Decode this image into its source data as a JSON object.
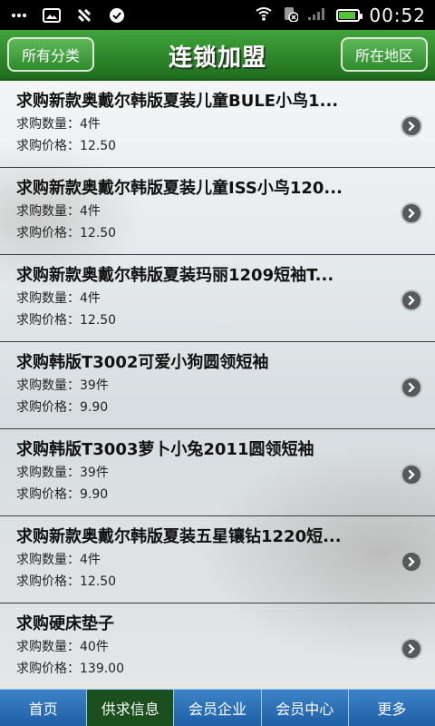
{
  "status_bar": {
    "time": "00:52",
    "left_icons": [
      "more-icon",
      "image-icon",
      "usb-debug-icon",
      "check-circle-icon"
    ],
    "right_icons": [
      "wifi-icon",
      "no-sim-icon",
      "signal-icon",
      "battery-icon"
    ],
    "battery_level": 0.8
  },
  "header": {
    "title": "连锁加盟",
    "left_button": "所有分类",
    "right_button": "所在地区"
  },
  "list": {
    "items": [
      {
        "title": "求购新款奥戴尔韩版夏装儿童BULE小鸟1...",
        "quantity_label": "求购数量：",
        "quantity": "4件",
        "price_label": "求购价格：",
        "price": "12.50"
      },
      {
        "title": "求购新款奥戴尔韩版夏装儿童ISS小鸟120...",
        "quantity_label": "求购数量：",
        "quantity": "4件",
        "price_label": "求购价格：",
        "price": "12.50"
      },
      {
        "title": "求购新款奥戴尔韩版夏装玛丽1209短袖T...",
        "quantity_label": "求购数量：",
        "quantity": "4件",
        "price_label": "求购价格：",
        "price": "12.50"
      },
      {
        "title": "求购韩版T3002可爱小狗圆领短袖",
        "quantity_label": "求购数量：",
        "quantity": "39件",
        "price_label": "求购价格：",
        "price": "9.90"
      },
      {
        "title": "求购韩版T3003萝卜小兔2011圆领短袖",
        "quantity_label": "求购数量：",
        "quantity": "39件",
        "price_label": "求购价格：",
        "price": "9.90"
      },
      {
        "title": "求购新款奥戴尔韩版夏装五星镶钻1220短...",
        "quantity_label": "求购数量：",
        "quantity": "4件",
        "price_label": "求购价格：",
        "price": "12.50"
      },
      {
        "title": "求购硬床垫子",
        "quantity_label": "求购数量：",
        "quantity": "40件",
        "price_label": "求购价格：",
        "price": "139.00"
      }
    ]
  },
  "bottom_nav": {
    "tabs": [
      "首页",
      "供求信息",
      "会员企业",
      "会员中心",
      "更多"
    ],
    "active_index": 1
  }
}
